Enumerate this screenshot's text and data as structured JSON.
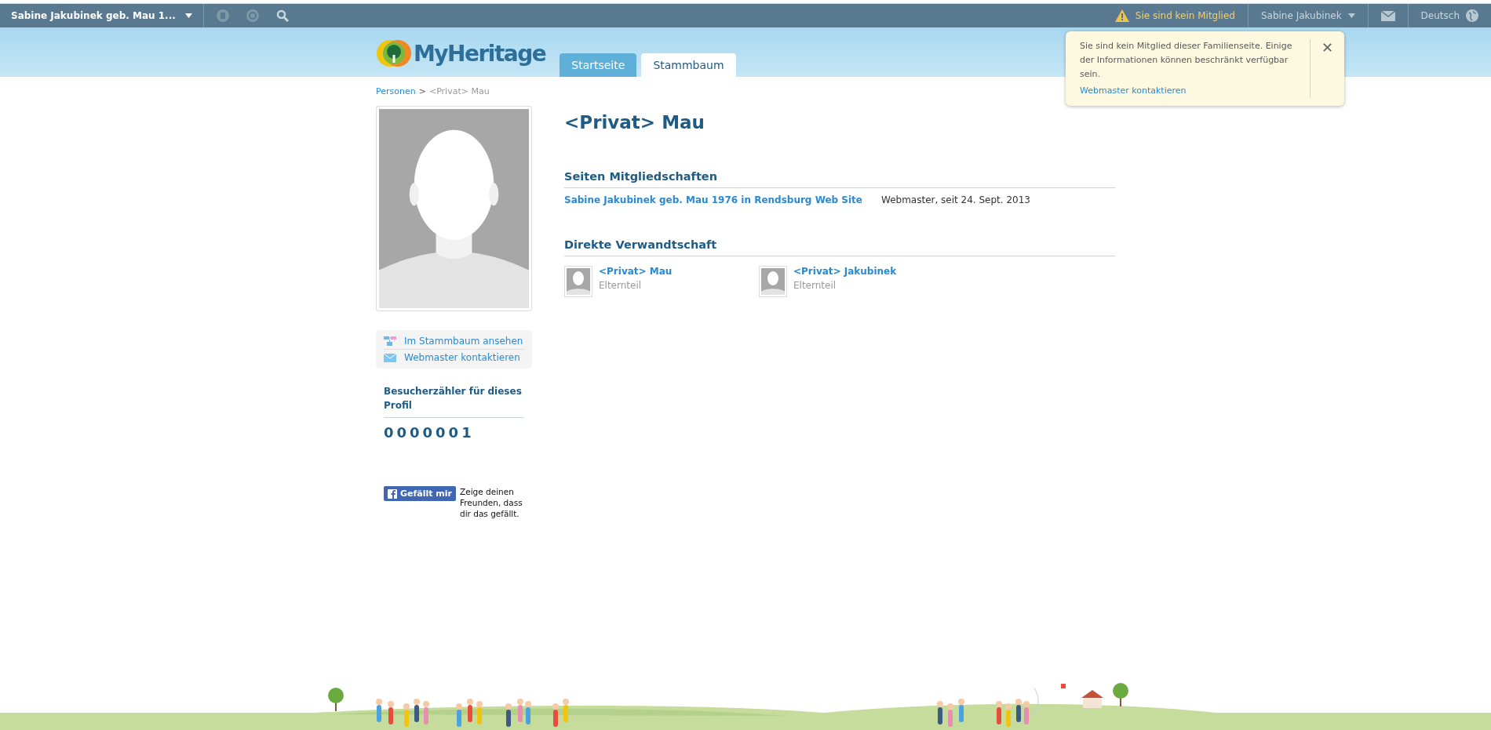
{
  "top_bar": {
    "site_title": "Sabine Jakubinek geb. Mau 1...",
    "member_warning": "Sie sind kein Mitglied",
    "user_name": "Sabine Jakubinek",
    "language": "Deutsch"
  },
  "logo": {
    "text": "MyHeritage"
  },
  "tabs": [
    {
      "label": "Startseite",
      "selected": false
    },
    {
      "label": "Stammbaum",
      "selected": true
    }
  ],
  "notice": {
    "text": "Sie sind kein Mitglied dieser Familienseite. Einige der Informationen können beschränkt verfügbar sein.",
    "link": "Webmaster kontaktieren",
    "close": "✕"
  },
  "breadcrumb": {
    "link": "Personen",
    "separator": ">",
    "current": "<Privat> Mau"
  },
  "sidebar": {
    "actions": [
      {
        "kind": "tree",
        "label": "Im Stammbaum ansehen"
      },
      {
        "kind": "mail",
        "label": "Webmaster kontaktieren"
      }
    ],
    "counter": {
      "title": "Besucherzähler für dieses Profil",
      "value": "0000001"
    },
    "like": {
      "button": "Gefällt mir",
      "text": "Zeige deinen Freunden, dass dir das gefällt."
    }
  },
  "profile": {
    "name": "<Privat> Mau",
    "membership": {
      "heading": "Seiten Mitgliedschaften",
      "site": "Sabine Jakubinek geb. Mau 1976 in Rendsburg Web Site",
      "role": "Webmaster, seit 24. Sept. 2013"
    },
    "relatives": {
      "heading": "Direkte Verwandtschaft",
      "items": [
        {
          "name": "<Privat> Mau",
          "relation": "Elternteil"
        },
        {
          "name": "<Privat> Jakubinek",
          "relation": "Elternteil"
        }
      ]
    }
  }
}
